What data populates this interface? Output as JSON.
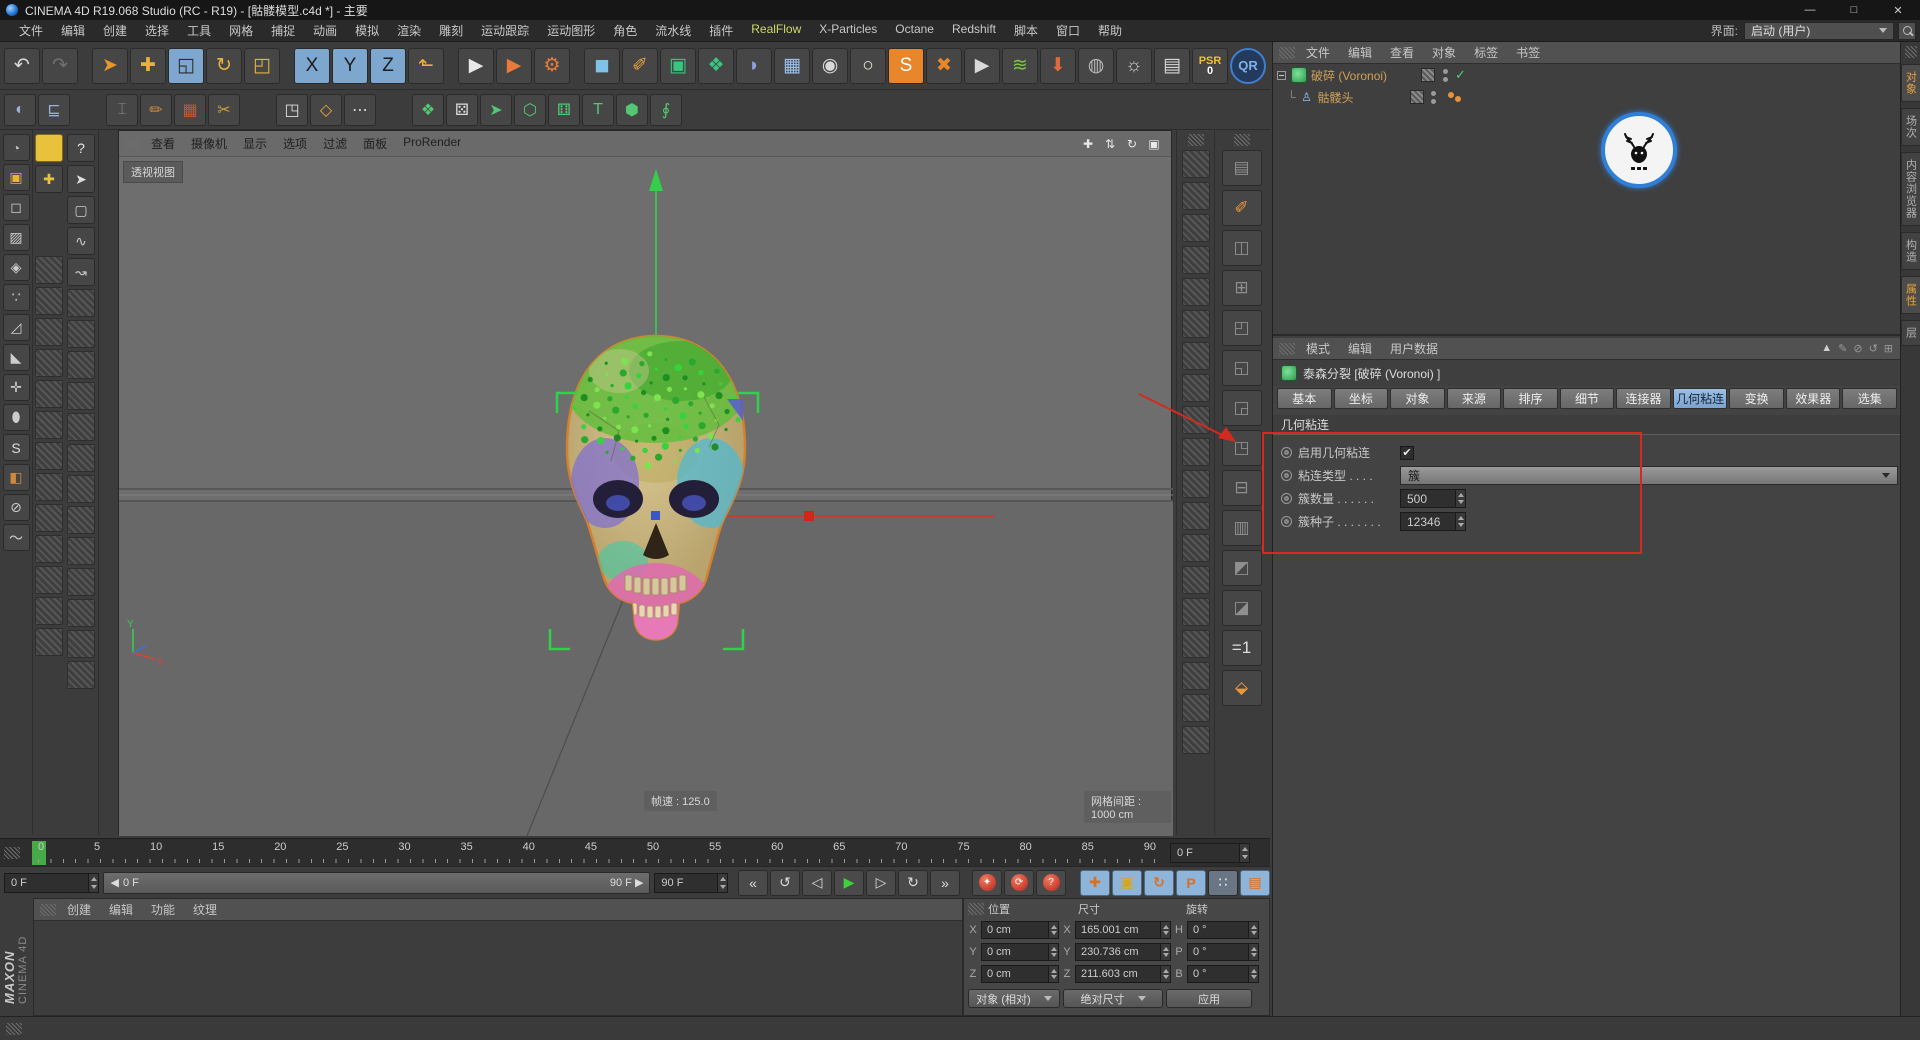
{
  "window": {
    "title": "CINEMA 4D R19.068 Studio (RC - R19) - [骷髅模型.c4d *] - 主要",
    "minimize": "—",
    "maximize": "□",
    "close": "✕"
  },
  "menubar": {
    "items": [
      {
        "label": "文件"
      },
      {
        "label": "编辑"
      },
      {
        "label": "创建"
      },
      {
        "label": "选择"
      },
      {
        "label": "工具"
      },
      {
        "label": "网格"
      },
      {
        "label": "捕捉"
      },
      {
        "label": "动画"
      },
      {
        "label": "模拟"
      },
      {
        "label": "渲染"
      },
      {
        "label": "雕刻"
      },
      {
        "label": "运动跟踪"
      },
      {
        "label": "运动图形"
      },
      {
        "label": "角色"
      },
      {
        "label": "流水线"
      },
      {
        "label": "插件"
      },
      {
        "label": "RealFlow",
        "accent": true
      },
      {
        "label": "X-Particles"
      },
      {
        "label": "Octane"
      },
      {
        "label": "Redshift"
      },
      {
        "label": "脚本"
      },
      {
        "label": "窗口"
      },
      {
        "label": "帮助"
      }
    ],
    "interface_label": "界面:",
    "interface_value": "启动 (用户)"
  },
  "toolbar_main": {
    "icons": [
      {
        "name": "undo-icon",
        "glyph": "↶",
        "fg": "#d8d8d8"
      },
      {
        "name": "redo-icon",
        "glyph": "↷",
        "fg": "#707070"
      },
      {
        "sep": true
      },
      {
        "name": "live-selection-icon",
        "glyph": "➤",
        "fg": "#e8962c"
      },
      {
        "name": "move-icon",
        "glyph": "✚",
        "fg": "#e8b23c"
      },
      {
        "name": "scale-icon",
        "glyph": "◱",
        "fg": "#2c2c2c",
        "bg": "#7ea7cf"
      },
      {
        "name": "rotate-icon",
        "glyph": "↻",
        "fg": "#e8b23c"
      },
      {
        "name": "last-tool-icon",
        "glyph": "◰",
        "fg": "#e8b23c"
      },
      {
        "sep": true
      },
      {
        "name": "lock-x-icon",
        "glyph": "X",
        "fg": "#1c1c1c",
        "bg": "#7ea7cf"
      },
      {
        "name": "lock-y-icon",
        "glyph": "Y",
        "fg": "#1c1c1c",
        "bg": "#7ea7cf"
      },
      {
        "name": "lock-z-icon",
        "glyph": "Z",
        "fg": "#1c1c1c",
        "bg": "#7ea7cf"
      },
      {
        "name": "coord-system-icon",
        "glyph": "⬑",
        "fg": "#e8b23c"
      },
      {
        "sep": true
      },
      {
        "name": "render-view-icon",
        "glyph": "▶",
        "fg": "#e8e8e8"
      },
      {
        "name": "render-picture-icon",
        "glyph": "▶",
        "fg": "#e87a3c"
      },
      {
        "name": "render-settings-icon",
        "glyph": "⚙",
        "fg": "#e87a3c"
      },
      {
        "sep": true
      },
      {
        "name": "primitive-cube-icon",
        "glyph": "◼",
        "fg": "#7ec3e8"
      },
      {
        "name": "spline-pen-icon",
        "glyph": "✐",
        "fg": "#e8a13c"
      },
      {
        "name": "subdivision-surface-icon",
        "glyph": "▣",
        "fg": "#39c77f"
      },
      {
        "name": "generator-icon",
        "glyph": "❖",
        "fg": "#39c77f"
      },
      {
        "name": "deformer-icon",
        "glyph": "◗",
        "fg": "#8f9fe0"
      },
      {
        "name": "floor-icon",
        "glyph": "▦",
        "fg": "#9fc3e8"
      },
      {
        "name": "camera-icon",
        "glyph": "◉",
        "fg": "#d8d8d8"
      },
      {
        "name": "light-icon",
        "glyph": "○",
        "fg": "#f0f0e0"
      },
      {
        "name": "sky-icon",
        "glyph": "S",
        "fg": "#ffffff",
        "bg": "#e8862c"
      },
      {
        "name": "xparticles-icon",
        "glyph": "✖",
        "fg": "#e8862c"
      },
      {
        "name": "clapper-icon",
        "glyph": "▶",
        "fg": "#d8d8d8"
      },
      {
        "name": "realflow-icon",
        "glyph": "≋",
        "fg": "#7fc24c"
      },
      {
        "name": "gravity-icon",
        "glyph": "⬇",
        "fg": "#e06a3a"
      },
      {
        "name": "field-sphere-icon",
        "glyph": "◍",
        "fg": "#bbbbbb"
      },
      {
        "name": "spline-field-icon",
        "glyph": "☼",
        "fg": "#cccccc"
      },
      {
        "name": "workplane-icon",
        "glyph": "▤",
        "fg": "#d8d8d8"
      }
    ],
    "psr_label": "PSR",
    "psr_value": "0",
    "qr_label": "QR"
  },
  "toolbar_second": {
    "icons": [
      {
        "name": "earth-icon",
        "glyph": "◐",
        "fg": "#9ab0d8"
      },
      {
        "name": "range-slider-icon",
        "glyph": "⊑",
        "fg": "#9ab0d8"
      },
      {
        "sep": true
      },
      {
        "name": "pair-tool-icon",
        "glyph": "⌶",
        "fg": "#8a8a8a"
      },
      {
        "name": "brush-points-icon",
        "glyph": "✏",
        "fg": "#d08a3a"
      },
      {
        "name": "cube-points-icon",
        "glyph": "▦",
        "fg": "#c05a3a"
      },
      {
        "name": "knife-icon",
        "glyph": "✂",
        "fg": "#d0a03a"
      },
      {
        "sep": true
      },
      {
        "name": "snap-square-icon",
        "glyph": "◳",
        "fg": "#dddddd"
      },
      {
        "name": "snap-diamond-icon",
        "glyph": "◇",
        "fg": "#e8a33c"
      },
      {
        "name": "grid-dots-icon",
        "glyph": "⋯",
        "fg": "#dddddd"
      },
      {
        "sep": true
      },
      {
        "name": "cluster-icon",
        "glyph": "❖",
        "fg": "#53c773"
      },
      {
        "name": "dice-icon",
        "glyph": "⚄",
        "fg": "#dddddd"
      },
      {
        "name": "green-arrow-icon",
        "glyph": "➤",
        "fg": "#53c773"
      },
      {
        "name": "voronoi-fracture-icon",
        "glyph": "⬡",
        "fg": "#53c773"
      },
      {
        "name": "dice-cube-icon",
        "glyph": "⚅",
        "fg": "#53c773"
      },
      {
        "name": "text-tool-icon",
        "glyph": "T",
        "fg": "#53c773"
      },
      {
        "name": "cube-green-icon",
        "glyph": "⬢",
        "fg": "#53c773"
      },
      {
        "name": "spiral-icon",
        "glyph": "∮",
        "fg": "#53c773"
      }
    ]
  },
  "left_toolbar": {
    "icons": [
      {
        "name": "render-region-icon",
        "glyph": "◔",
        "fg": "#bbbbbb"
      },
      {
        "name": "make-editable-icon",
        "glyph": "▣",
        "fg": "#e8b43c"
      },
      {
        "name": "model-mode-icon",
        "glyph": "◻",
        "fg": "#cccccc"
      },
      {
        "name": "texture-mode-icon",
        "glyph": "▨",
        "fg": "#cccccc"
      },
      {
        "name": "workplane-mode-icon",
        "glyph": "◈",
        "fg": "#cccccc"
      },
      {
        "name": "points-mode-icon",
        "glyph": "∵",
        "fg": "#cccccc"
      },
      {
        "name": "edges-mode-icon",
        "glyph": "◿",
        "fg": "#cccccc"
      },
      {
        "name": "polygons-mode-icon",
        "glyph": "◣",
        "fg": "#cccccc"
      },
      {
        "name": "axis-mode-icon",
        "glyph": "✛",
        "fg": "#cccccc"
      },
      {
        "name": "mouse-mode-icon",
        "glyph": "⬮",
        "fg": "#cccccc"
      },
      {
        "name": "viewport-solo-icon",
        "glyph": "S",
        "fg": "#dddddd"
      },
      {
        "name": "paint-bucket-icon",
        "glyph": "◧",
        "fg": "#d0893a"
      },
      {
        "name": "snap-lock-icon",
        "glyph": "⊘",
        "fg": "#cccccc"
      },
      {
        "name": "spring-icon",
        "glyph": "〜",
        "fg": "#cccccc"
      }
    ],
    "palette_icons": [
      {
        "name": "help-icon",
        "glyph": "?",
        "fg": "#e8e8e8"
      },
      {
        "name": "cursor-icon",
        "glyph": "➤",
        "fg": "#dddddd"
      },
      {
        "name": "box-tool-icon",
        "glyph": "▢",
        "fg": "#cccccc"
      },
      {
        "name": "spline-a-icon",
        "glyph": "∿",
        "fg": "#cccccc"
      },
      {
        "name": "spline-b-icon",
        "glyph": "↝",
        "fg": "#cccccc"
      }
    ],
    "swatch_plus": "✚"
  },
  "right_columns": {
    "icons": [
      {
        "name": "display-filter-icon",
        "glyph": "▤"
      },
      {
        "name": "wrench-tool-icon",
        "glyph": "✐",
        "fg": "#e8973c"
      },
      {
        "name": "cube-stack-icon",
        "glyph": "◫"
      },
      {
        "name": "axis-cube-icon",
        "glyph": "⊞"
      },
      {
        "name": "magnet-icon",
        "glyph": "◰"
      },
      {
        "name": "array-icon",
        "glyph": "◱"
      },
      {
        "name": "mirror-icon",
        "glyph": "◲"
      },
      {
        "name": "extrude-icon",
        "glyph": "◳"
      },
      {
        "name": "lathe-icon",
        "glyph": "⊟"
      },
      {
        "name": "sweep-icon",
        "glyph": "▥"
      },
      {
        "name": "loft-icon",
        "glyph": "◩"
      },
      {
        "name": "boole-icon",
        "glyph": "◪"
      },
      {
        "name": "lod-icon",
        "glyph": "=1",
        "fg": "#dddddd"
      },
      {
        "name": "settings-cube-icon",
        "glyph": "⬙",
        "fg": "#e8973c"
      }
    ]
  },
  "viewport": {
    "menu": [
      {
        "label": "查看"
      },
      {
        "label": "摄像机"
      },
      {
        "label": "显示"
      },
      {
        "label": "选项"
      },
      {
        "label": "过滤"
      },
      {
        "label": "面板"
      },
      {
        "label": "ProRender"
      }
    ],
    "nav_icons": [
      {
        "name": "pan-view-icon",
        "glyph": "✚"
      },
      {
        "name": "zoom-view-icon",
        "glyph": "⇅"
      },
      {
        "name": "rotate-view-icon",
        "glyph": "↻"
      },
      {
        "name": "maximize-view-icon",
        "glyph": "▣"
      }
    ],
    "view_label": "透视视图",
    "fps_text": "帧速 : 125.0",
    "grid_text": "网格间距 : 1000 cm"
  },
  "object_manager": {
    "menu": [
      {
        "label": "文件"
      },
      {
        "label": "编辑"
      },
      {
        "label": "查看"
      },
      {
        "label": "对象"
      },
      {
        "label": "标签"
      },
      {
        "label": "书签"
      }
    ],
    "objects": [
      {
        "label": "破碎 (Voronoi)"
      },
      {
        "label": "骷髅头"
      }
    ]
  },
  "attribute_manager": {
    "menu": [
      {
        "label": "模式"
      },
      {
        "label": "编辑"
      },
      {
        "label": "用户数据"
      }
    ],
    "tool_icons": [
      {
        "name": "attr-nav-icon",
        "glyph": "▲",
        "fg": "#cfcfcf"
      },
      {
        "name": "attr-pin-icon",
        "glyph": "✎",
        "fg": "#9a9a9a"
      },
      {
        "name": "attr-lock-icon",
        "glyph": "⊘",
        "fg": "#9a9a9a"
      },
      {
        "name": "attr-history-icon",
        "glyph": "↺",
        "fg": "#9a9a9a"
      },
      {
        "name": "attr-newpanel-icon",
        "glyph": "⊞",
        "fg": "#9a9a9a"
      }
    ],
    "title": "泰森分裂 [破碎 (Voronoi) ]",
    "tabs": [
      {
        "label": "基本"
      },
      {
        "label": "坐标"
      },
      {
        "label": "对象"
      },
      {
        "label": "来源"
      },
      {
        "label": "排序"
      },
      {
        "label": "细节"
      },
      {
        "label": "连接器"
      },
      {
        "label": "几何粘连",
        "active": true
      },
      {
        "label": "变换"
      },
      {
        "label": "效果器"
      },
      {
        "label": "选集"
      }
    ],
    "section_title": "几何粘连",
    "enable_label": "启用几何粘连",
    "enable_check": "✔",
    "type_label": "粘连类型 . . . .",
    "type_value": "簇",
    "count_label": "簇数量 . . . . . .",
    "count_value": "500",
    "seed_label": "簇种子 . . . . . . .",
    "seed_value": "12346"
  },
  "timeline": {
    "ticks": [
      "0",
      "5",
      "10",
      "15",
      "20",
      "25",
      "30",
      "35",
      "40",
      "45",
      "50",
      "55",
      "60",
      "65",
      "70",
      "75",
      "80",
      "85",
      "90"
    ],
    "ruler_end": "0 F"
  },
  "transport": {
    "current": "0 F",
    "slider_start": "0 F",
    "slider_end": "90 F ▶",
    "slider_start_arrow": "◀",
    "range_end": "90 F",
    "buttons": [
      {
        "name": "goto-start-button",
        "glyph": "«"
      },
      {
        "name": "play-reverse-button",
        "glyph": "↺"
      },
      {
        "name": "prev-frame-button",
        "glyph": "◁"
      },
      {
        "name": "play-button",
        "glyph": "▶",
        "fg": "#3ed13e"
      },
      {
        "name": "next-frame-button",
        "glyph": "▷"
      },
      {
        "name": "play-mode-button",
        "glyph": "↻"
      },
      {
        "name": "goto-end-button",
        "glyph": "»"
      }
    ],
    "record_buttons": [
      {
        "name": "record-key-button",
        "glyph": "✦"
      },
      {
        "name": "autokey-button",
        "glyph": "⟳"
      },
      {
        "name": "keyframe-selection-button",
        "glyph": "?"
      }
    ],
    "toggle_buttons": [
      {
        "name": "toggle-position-button",
        "glyph": "✚",
        "fg": "#d96f1f",
        "cls": "blue"
      },
      {
        "name": "toggle-scale-button",
        "glyph": "▣",
        "fg": "#d9a51f",
        "cls": "blue"
      },
      {
        "name": "toggle-rotation-button",
        "glyph": "↻",
        "fg": "#d96f1f",
        "cls": "blue"
      },
      {
        "name": "toggle-parameter-button",
        "glyph": "P",
        "fg": "#d96f1f",
        "cls": "blue"
      },
      {
        "name": "toggle-pla-button",
        "glyph": "∷",
        "fg": "#eef4fa",
        "cls": "grey"
      },
      {
        "name": "timeline-window-button",
        "glyph": "▤",
        "fg": "#d96f1f",
        "cls": "blue"
      }
    ]
  },
  "material_manager": {
    "menu": [
      {
        "label": "创建"
      },
      {
        "label": "编辑"
      },
      {
        "label": "功能"
      },
      {
        "label": "纹理"
      }
    ]
  },
  "coordinates": {
    "headers": [
      "位置",
      "尺寸",
      "旋转"
    ],
    "rows": [
      {
        "pl": "X",
        "pv": "0 cm",
        "sl": "X",
        "sv": "165.001 cm",
        "rl": "H",
        "rv": "0 °"
      },
      {
        "pl": "Y",
        "pv": "0 cm",
        "sl": "Y",
        "sv": "230.736 cm",
        "rl": "P",
        "rv": "0 °"
      },
      {
        "pl": "Z",
        "pv": "0 cm",
        "sl": "Z",
        "sv": "211.603 cm",
        "rl": "B",
        "rv": "0 °"
      }
    ],
    "mode_button": "对象 (相对)",
    "size_button": "绝对尺寸",
    "apply_button": "应用"
  },
  "right_tabs": {
    "items": [
      {
        "label": "对象",
        "active": true
      },
      {
        "label": "场次"
      },
      {
        "label": "内容浏览器"
      },
      {
        "label": "构造"
      },
      {
        "label": "属性",
        "active": true,
        "cls": "gap"
      },
      {
        "label": "层"
      }
    ]
  },
  "branding": {
    "maxon": "MAXON",
    "cinema": "CINEMA 4D"
  },
  "colors": {
    "accent_orange": "#e8862c",
    "selection_blue": "#7ea7cf",
    "annotation_red": "#d42a20",
    "gizmo_green": "#35d04a",
    "viewport_grey": "#6e6e6e"
  }
}
